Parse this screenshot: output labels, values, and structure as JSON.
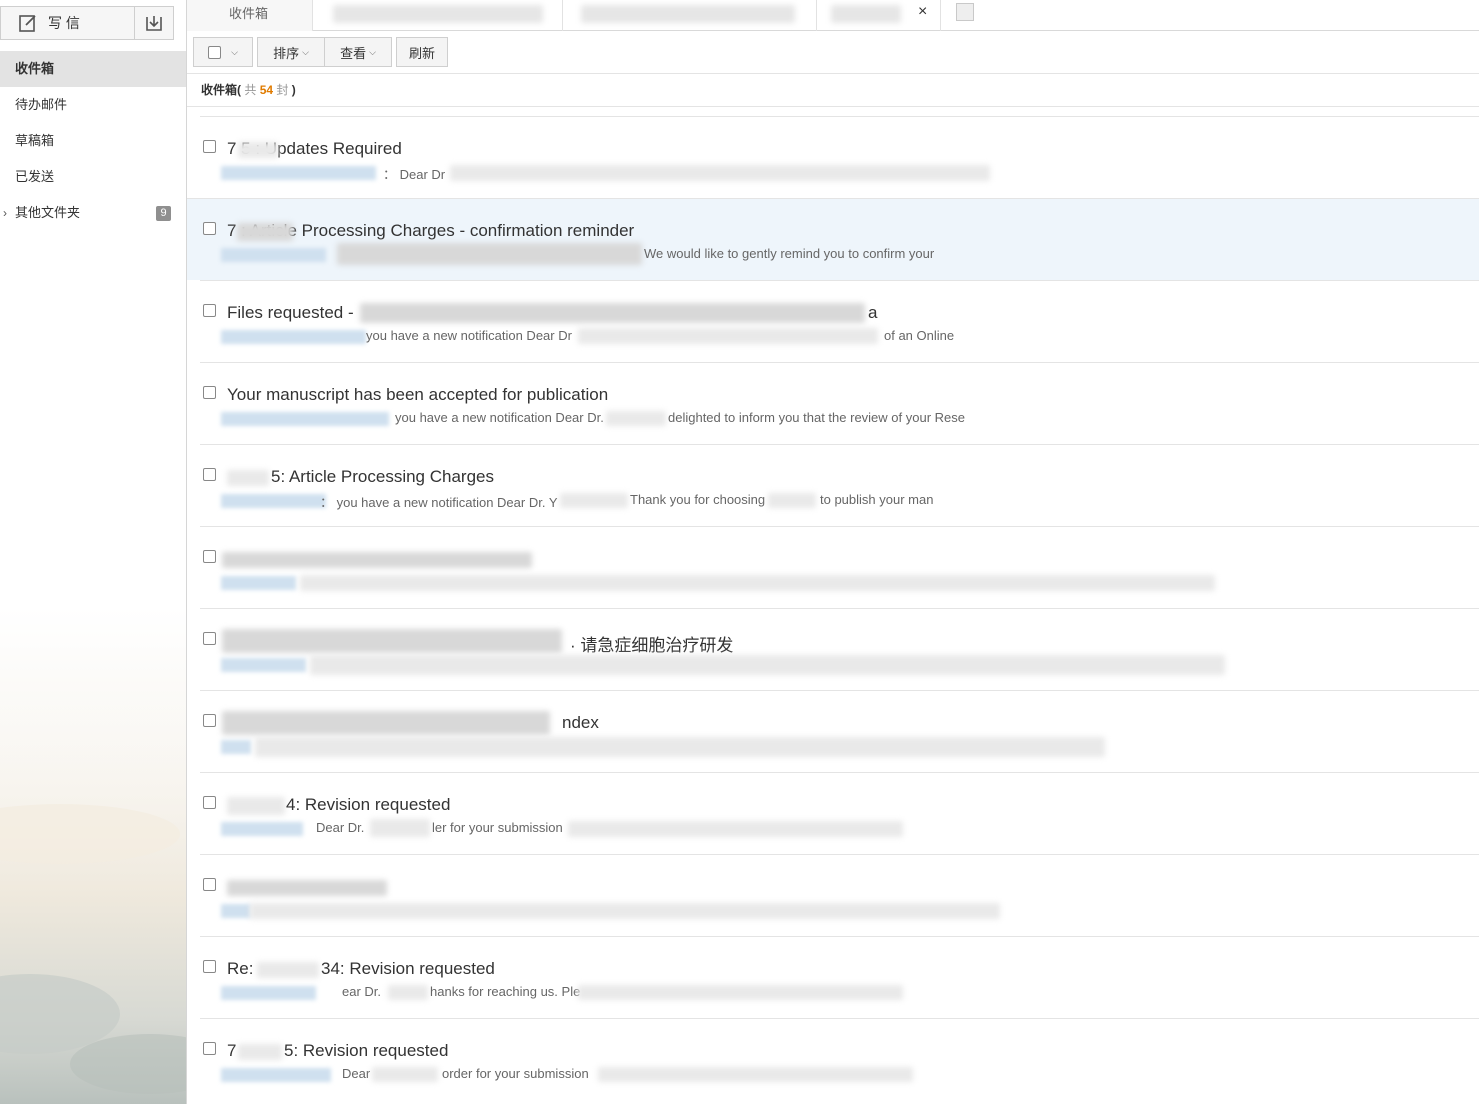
{
  "sidebar": {
    "compose_label": "写 信",
    "folders": [
      {
        "label": "收件箱",
        "active": true
      },
      {
        "label": "待办邮件"
      },
      {
        "label": "草稿箱"
      },
      {
        "label": "已发送"
      },
      {
        "label": "其他文件夹",
        "count": "9"
      }
    ]
  },
  "tabs": {
    "first": "收件箱"
  },
  "toolbar": {
    "sort_label": "排序",
    "view_label": "查看",
    "refresh_label": "刷新"
  },
  "list_header": {
    "folder": "收件箱",
    "open": "(",
    "prefix": "共",
    "count": "54",
    "suffix": "封",
    "close": ")"
  },
  "mails": [
    {
      "subject": "7        5 : Updates Required",
      "preview": "：  Dear Dr"
    },
    {
      "subject": "7          : Article Processing Charges - confirmation reminder",
      "preview": "We would like to gently remind you to confirm your"
    },
    {
      "subject": "Files requested -",
      "preview": "you have a new notification Dear Dr",
      "tail": "a",
      "preview_tail": "of an Online"
    },
    {
      "subject": "Your manuscript has been accepted for publication",
      "preview": "you have a new notification Dear Dr.",
      "preview_tail": "delighted to inform you that the review of your Rese"
    },
    {
      "subject": "5: Article Processing Charges",
      "preview": "：  you have a new notification Dear Dr. Y",
      "preview_mid": "Thank you for choosing",
      "preview_tail": "to publish your man"
    },
    {
      "subject": "",
      "preview": ""
    },
    {
      "subject": "· 请急症细胞治疗研发",
      "preview": ""
    },
    {
      "subject": "ndex",
      "preview": ""
    },
    {
      "subject": "4: Revision requested",
      "preview": "Dear Dr.",
      "preview_tail": "ler for your submission"
    },
    {
      "subject": "",
      "preview": ""
    },
    {
      "subject": "Re:",
      "subject_tail": "34: Revision requested",
      "preview": "ear Dr.",
      "preview_tail": "hanks for reaching us. Ple"
    },
    {
      "subject": "7",
      "subject_tail": "5: Revision requested",
      "preview": "Dear",
      "preview_tail": "order for your submission"
    }
  ]
}
